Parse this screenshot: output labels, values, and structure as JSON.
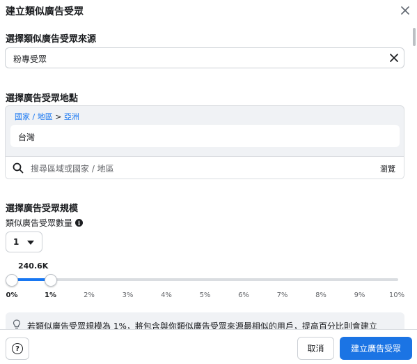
{
  "dialog": {
    "title": "建立類似廣告受眾"
  },
  "source": {
    "section_title": "選擇類似廣告受眾來源",
    "value": "粉專受眾"
  },
  "location": {
    "section_title": "選擇廣告受眾地點",
    "breadcrumb": {
      "part1": "國家 / 地區",
      "separator": ">",
      "part2": "亞洲"
    },
    "selected": "台灣",
    "search_placeholder": "搜尋區域或國家 / 地區",
    "browse_label": "瀏覽"
  },
  "size": {
    "section_title": "選擇廣告受眾規模",
    "count_label": "類似廣告受眾數量",
    "count_value": "1",
    "reach_value": "240.6K",
    "slider": {
      "min_percent": 0,
      "max_percent": 10,
      "selected_start_percent": 0,
      "selected_end_percent": 1,
      "ticks": [
        "0%",
        "1%",
        "2%",
        "3%",
        "4%",
        "5%",
        "6%",
        "7%",
        "8%",
        "9%",
        "10%"
      ]
    }
  },
  "hint_text": "若類似廣告受眾規模為 1%，將包含與你類似廣告受眾來源最相似的用戶，提高百分比則會建立",
  "footer": {
    "cancel_label": "取消",
    "create_label": "建立廣告受眾"
  },
  "colors": {
    "accent": "#1877f2",
    "primary_button": "#1b74e4",
    "panel_bg": "#f0f2f5"
  },
  "icons": {
    "close": "close-icon",
    "clear": "clear-icon",
    "search": "search-icon",
    "info": "info-icon",
    "caret": "caret-down-icon",
    "bulb": "lightbulb-icon",
    "help": "help-icon"
  }
}
